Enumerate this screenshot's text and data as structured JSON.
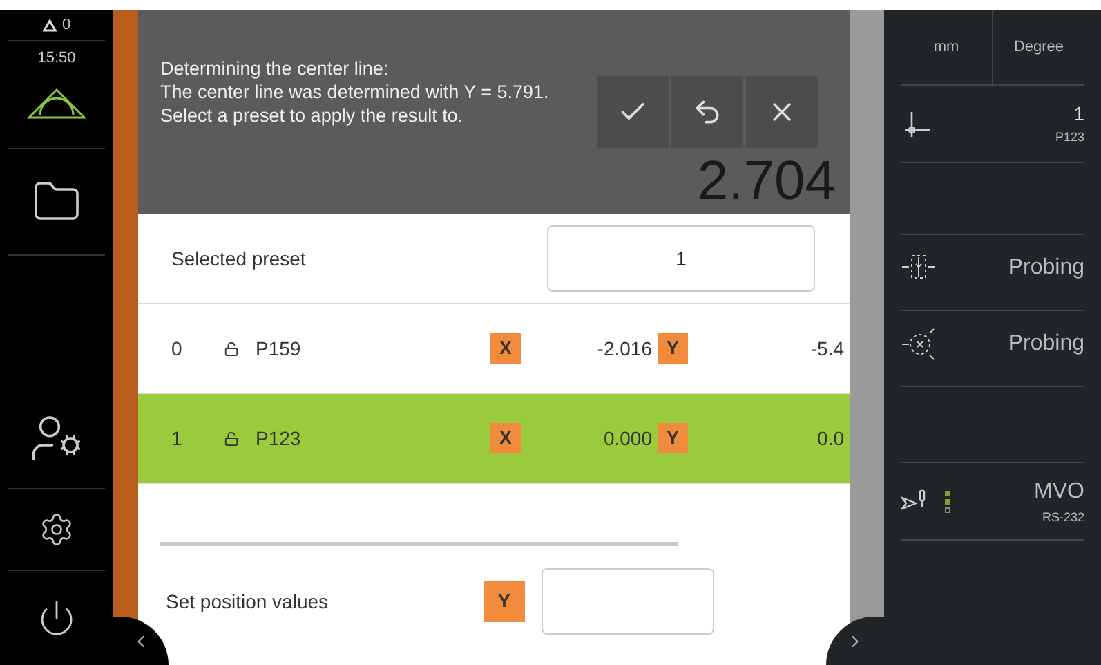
{
  "sidebar": {
    "warnings": "0",
    "time": "15:50"
  },
  "background": {
    "display_value": "2.704"
  },
  "dialog": {
    "message_lines": [
      "Determining the center line:",
      "The center line was determined with Y = 5.791.",
      "Select a preset to apply the result to."
    ],
    "selected_preset": {
      "label": "Selected preset",
      "value": "1"
    },
    "presets": [
      {
        "number": "0",
        "name": "P159",
        "x_label": "X",
        "x_value": "-2.016",
        "y_label": "Y",
        "y_value": "-5.4",
        "selected": false
      },
      {
        "number": "1",
        "name": "P123",
        "x_label": "X",
        "x_value": "0.000",
        "y_label": "Y",
        "y_value": "0.0",
        "selected": true
      }
    ],
    "position": {
      "label": "Set position values",
      "axis": "Y"
    }
  },
  "right_panel": {
    "units": [
      "mm",
      "Degree"
    ],
    "preset": {
      "number": "1",
      "name": "P123"
    },
    "functions": [
      {
        "kind": "edge",
        "label": "Probing"
      },
      {
        "kind": "center",
        "label": "Probing"
      }
    ],
    "sensor": {
      "name": "MVO",
      "port": "RS-232"
    }
  }
}
